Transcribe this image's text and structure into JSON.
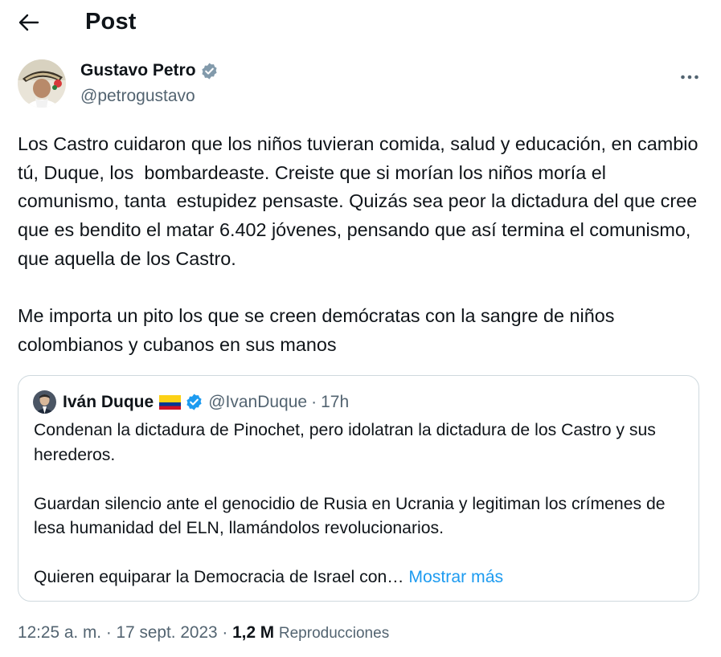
{
  "header": {
    "title": "Post",
    "back_icon": "arrow-left-icon"
  },
  "author": {
    "name": "Gustavo Petro",
    "handle": "@petrogustavo",
    "verified_icon": "verified-badge-icon",
    "more_icon": "more-horizontal-icon"
  },
  "tweet": {
    "paragraphs": [
      "Los Castro cuidaron que los niños tuvieran comida, salud y educación, en cambio tú, Duque, los  bombardeaste. Creiste que si morían los niños moría el comunismo, tanta  estupidez pensaste. Quizás sea peor la dictadura del que cree que es bendito el matar 6.402 jóvenes, pensando que así termina el comunismo, que aquella de los Castro.",
      "Me importa un pito los que se creen demócratas con la sangre de niños colombianos y cubanos en sus manos"
    ]
  },
  "quote": {
    "name": "Iván Duque",
    "flag_icon": "colombia-flag-icon",
    "handle": "@IvanDuque",
    "separator": "·",
    "time": "17h",
    "paragraphs": [
      "Condenan la dictadura de Pinochet,  pero idolatran la dictadura de los Castro y sus herederos.",
      "Guardan silencio ante el genocidio de Rusia en Ucrania y legitiman los crímenes de lesa humanidad del ELN, llamándolos revolucionarios.",
      "Quieren equiparar la Democracia de Israel con…"
    ],
    "show_more": "Mostrar más"
  },
  "meta": {
    "time": "12:25 a. m.",
    "separator": "·",
    "date": "17 sept. 2023",
    "views_count": "1,2 M",
    "views_label": "Reproducciones"
  },
  "colors": {
    "text": "#0f1419",
    "secondary": "#536471",
    "accent": "#1d9bf0",
    "border": "#cfd9de"
  }
}
